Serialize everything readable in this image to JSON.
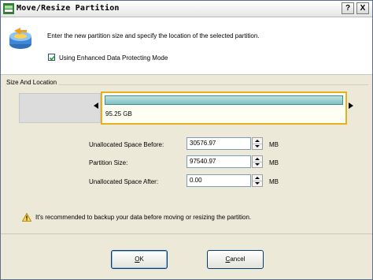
{
  "window": {
    "title": "Move/Resize Partition",
    "help_glyph": "?",
    "close_glyph": "X"
  },
  "header": {
    "intro": "Enter the new partition size and specify the location of the selected partition.",
    "icon": "partition-icon"
  },
  "option": {
    "label": "Using Enhanced Data Protecting Mode",
    "checked": true
  },
  "group": {
    "title": "Size And Location",
    "partition_label": "95.25 GB"
  },
  "fields": [
    {
      "label": "Unallocated Space Before:",
      "value": "30576.97",
      "unit": "MB"
    },
    {
      "label": "Partition Size:",
      "value": "97540.97",
      "unit": "MB"
    },
    {
      "label": "Unallocated Space After:",
      "value": "0.00",
      "unit": "MB"
    }
  ],
  "warning": {
    "text": "It's recommended to backup your data before moving or resizing the partition.",
    "icon": "warning-icon"
  },
  "buttons": {
    "ok_prefix": "",
    "ok_key": "O",
    "ok_rest": "K",
    "cancel_key": "C",
    "cancel_rest": "ancel"
  },
  "colors": {
    "partition_border": "#e8b020",
    "partition_bar": "#7fc1c1",
    "unallocated": "#dcdcdc"
  }
}
